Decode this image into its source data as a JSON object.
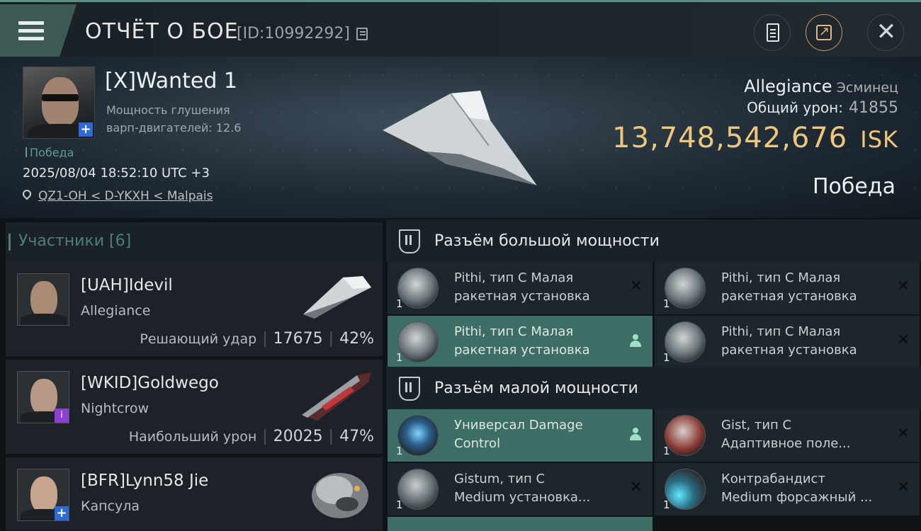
{
  "header": {
    "title": "ОТЧЁТ О БОЕ",
    "report_id": "[ID:10992292]"
  },
  "victim": {
    "name": "[X]Wanted 1",
    "stat_line1": "Мощность глушения",
    "stat_line2": "варп-двигателей: 12.6",
    "tag": "Победа",
    "datetime": "2025/08/04 18:52:10 UTC +3",
    "location": "QZ1-OH < D-YKXH < Malpais",
    "ship": "Allegiance",
    "ship_class": "Эсминец",
    "damage_label": "Общий урон:",
    "damage_value": "41855",
    "isk_value": "13,748,542,676",
    "isk_unit": "ISK",
    "result": "Победа"
  },
  "participants": {
    "header": "Участники [6]",
    "items": [
      {
        "name": "[UAH]Idevil",
        "ship": "Allegiance",
        "label": "Решающий удар",
        "damage": "17675",
        "percent": "42%"
      },
      {
        "name": "[WKID]Goldwego",
        "ship": "Nightcrow",
        "label": "Наибольший урон",
        "damage": "20025",
        "percent": "47%"
      },
      {
        "name": "[BFR]Lynn58 Jie",
        "ship": "Капсула"
      }
    ]
  },
  "high_slots": {
    "title": "Разъём большой мощности",
    "items": [
      {
        "line1": "Pithi, тип C Малая",
        "line2": "ракетная установка",
        "qty": "1"
      },
      {
        "line1": "Pithi, тип C Малая",
        "line2": "ракетная установка",
        "qty": "1"
      },
      {
        "line1": "Pithi, тип C Малая",
        "line2": "ракетная установка",
        "qty": "1"
      },
      {
        "line1": "Pithi, тип C Малая",
        "line2": "ракетная установка",
        "qty": "1"
      }
    ]
  },
  "low_slots": {
    "title": "Разъём малой мощности",
    "items": [
      {
        "line1": "Универсал Damage",
        "line2": "Control",
        "qty": "1"
      },
      {
        "line1": "Gist, тип C",
        "line2": "Адаптивное поле...",
        "qty": "1"
      },
      {
        "line1": "Gistum, тип C",
        "line2": "Medium установка...",
        "qty": "1"
      },
      {
        "line1": "Контрабандист",
        "line2": "Medium форсажный ...",
        "qty": "1"
      }
    ]
  },
  "colors": {
    "accent": "#3e6d66",
    "isk": "#f0c67a",
    "badge_blue": "#2d6ad6",
    "badge_purple": "#8d3fd4"
  }
}
